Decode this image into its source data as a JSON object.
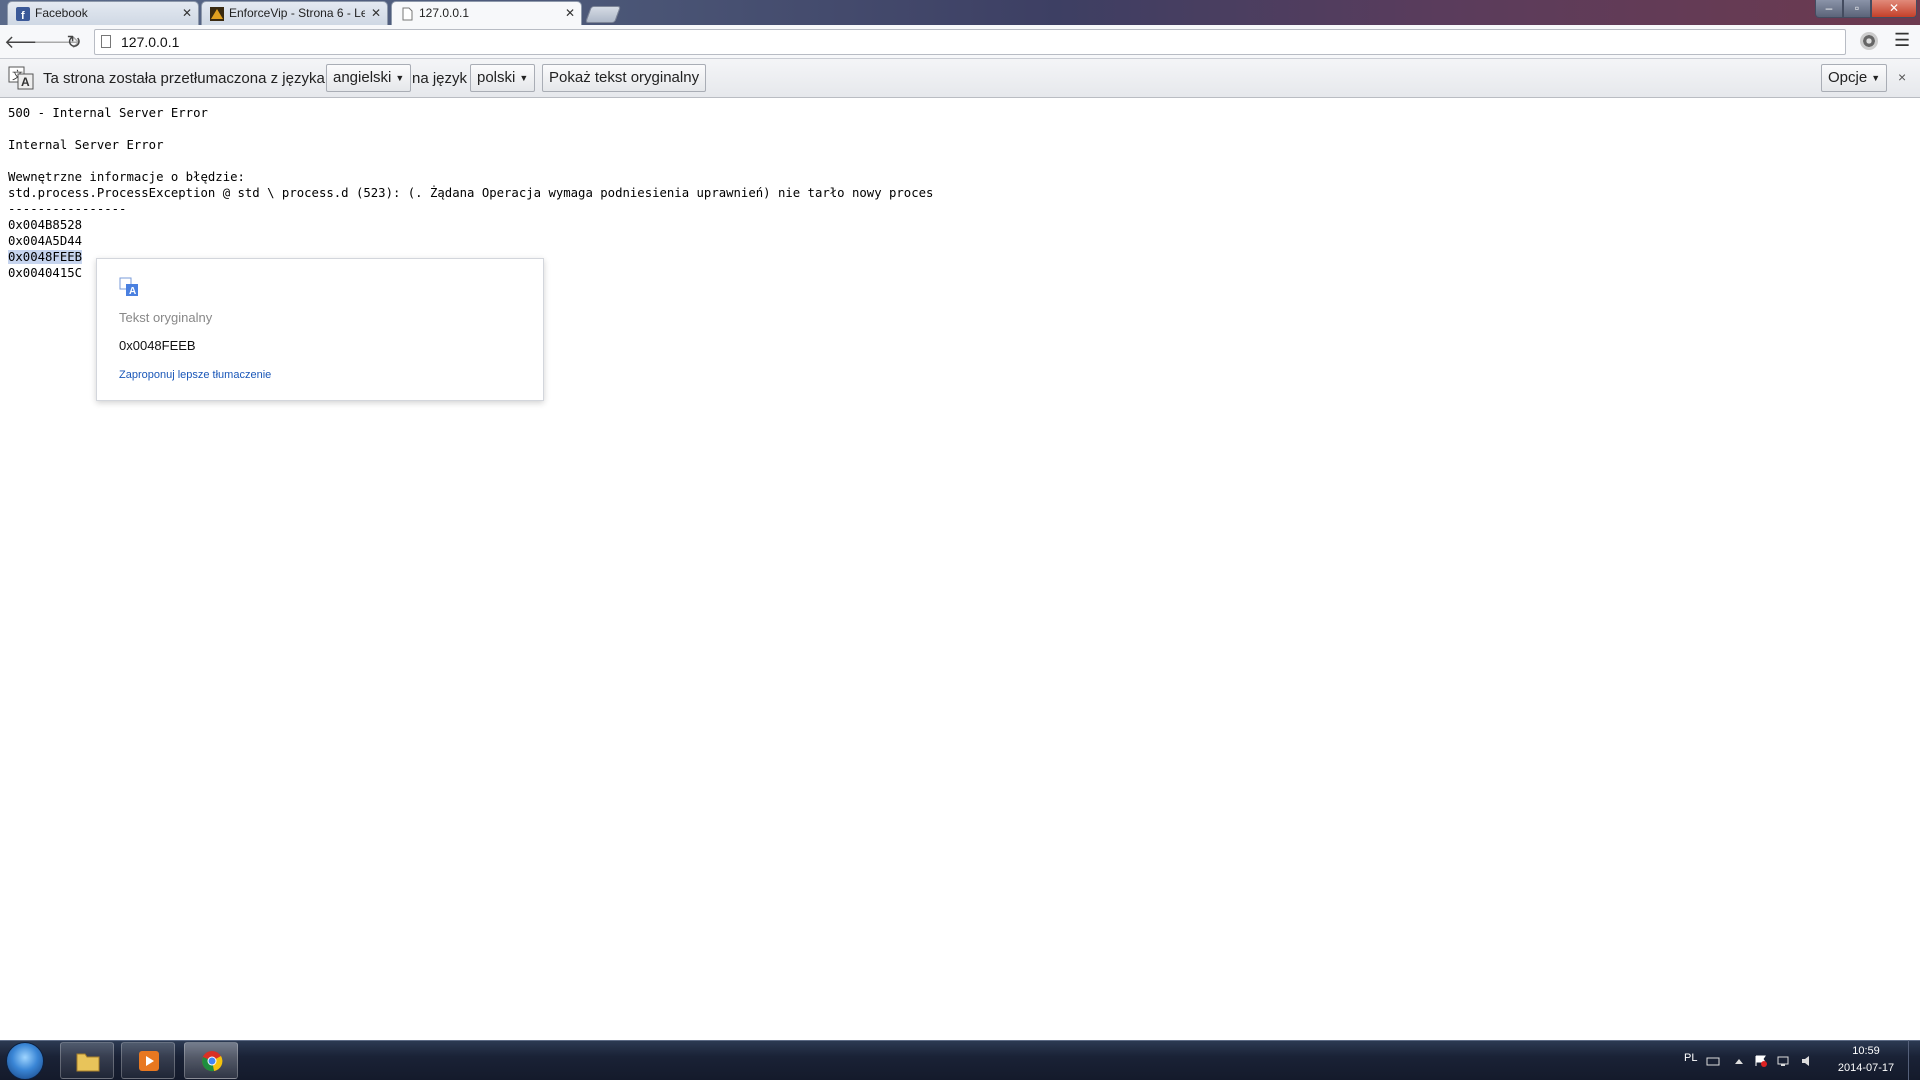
{
  "browser": {
    "tabs": [
      {
        "title": "Facebook",
        "icon": "facebook-icon",
        "active": false
      },
      {
        "title": "EnforceVip - Strona 6 - Le",
        "icon": "enforcevip-icon",
        "active": false
      },
      {
        "title": "127.0.0.1",
        "icon": "page-icon",
        "active": true
      }
    ],
    "tab_close": "✕",
    "url": "127.0.0.1",
    "window_controls": {
      "minimize": "‒",
      "maximize": "▫",
      "close": "✕"
    }
  },
  "translate_bar": {
    "text_before": "Ta strona została przetłumaczona z języka",
    "source_language": "angielski",
    "text_middle": "na język",
    "target_language": "polski",
    "show_original_button": "Pokaż tekst oryginalny",
    "options_button": "Opcje",
    "close": "×"
  },
  "page": {
    "lines": [
      "500 - Internal Server Error",
      "",
      "Internal Server Error",
      "",
      "Wewnętrzne informacje o błędzie:",
      "std.process.ProcessException @ std \\ process.d (523): (. Żądana Operacja wymaga podniesienia uprawnień) nie tarło nowy proces",
      "----------------",
      "0x004B8528",
      "0x004A5D44",
      "0x0048FEEB",
      "0x0040415C"
    ],
    "selected_line_index": 9
  },
  "translate_popup": {
    "heading": "Tekst oryginalny",
    "original_text": "0x0048FEEB",
    "suggest_link": "Zaproponuj lepsze tłumaczenie"
  },
  "taskbar": {
    "language": "PL",
    "time": "10:59",
    "date": "2014-07-17"
  }
}
